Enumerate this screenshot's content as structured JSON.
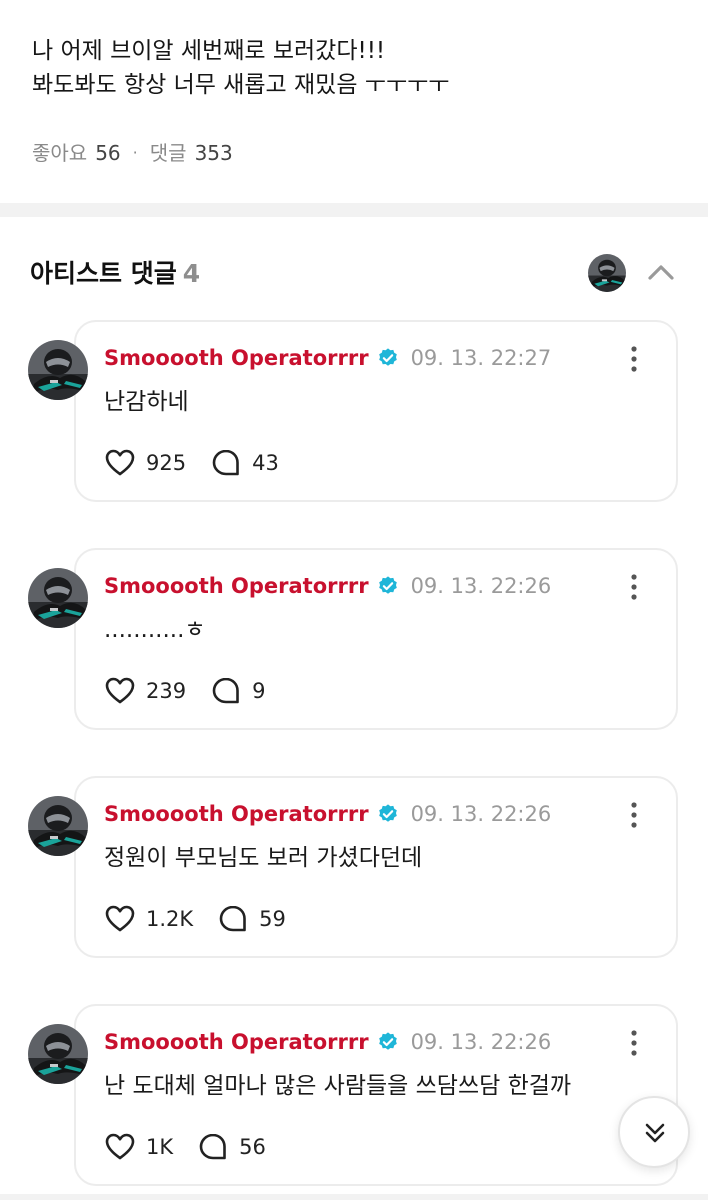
{
  "post": {
    "lines": [
      "나 어제 브이알 세번째로 보러갔다!!!",
      "봐도봐도 항상 너무 새롭고 재밌음 ㅜㅜㅜㅜ"
    ],
    "likes_label": "좋아요",
    "likes_count": "56",
    "comments_label": "댓글",
    "comments_count": "353"
  },
  "artist_comments": {
    "title": "아티스트 댓글",
    "count": "4",
    "items": [
      {
        "author": "Smooooth Operatorrrr",
        "timestamp": "09. 13. 22:27",
        "text": "난감하네",
        "likes": "925",
        "replies": "43"
      },
      {
        "author": "Smooooth Operatorrrr",
        "timestamp": "09. 13. 22:26",
        "text": "...........ㅎ",
        "likes": "239",
        "replies": "9"
      },
      {
        "author": "Smooooth Operatorrrr",
        "timestamp": "09. 13. 22:26",
        "text": "정원이 부모님도 보러 가셨다던데",
        "likes": "1.2K",
        "replies": "59"
      },
      {
        "author": "Smooooth Operatorrrr",
        "timestamp": "09. 13. 22:26",
        "text": "난 도대체 얼마나 많은 사람들을 쓰담쓰담 한걸까",
        "likes": "1K",
        "replies": "56"
      }
    ]
  },
  "colors": {
    "author": "#c8102e",
    "verified": "#1fb6d8",
    "divider": "#f2f2f2"
  },
  "icons": [
    "heart-icon",
    "comment-bubble-icon",
    "more-vertical-icon",
    "verified-badge-icon",
    "chevron-up-icon",
    "double-chevron-down-icon"
  ]
}
